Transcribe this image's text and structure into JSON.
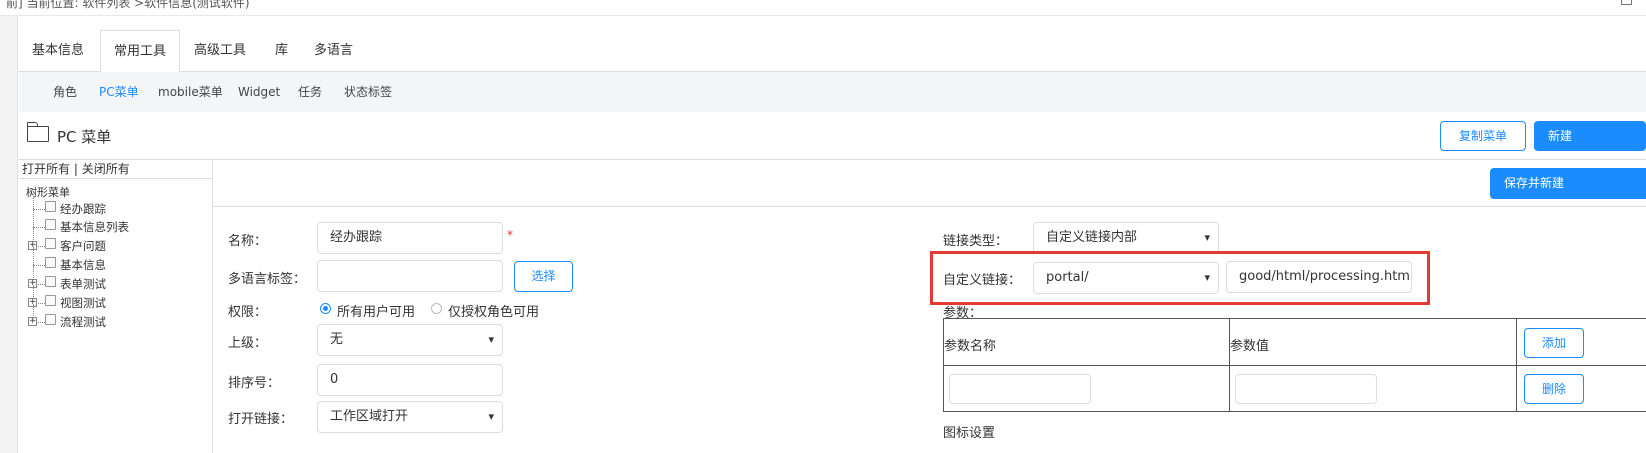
{
  "breadcrumb": {
    "text": "前]  当前位置: 软件列表 >软件信息(测试软件)"
  },
  "tabs": [
    {
      "label": "基本信息",
      "active": false
    },
    {
      "label": "常用工具",
      "active": true
    },
    {
      "label": "高级工具",
      "active": false
    },
    {
      "label": "库",
      "active": false
    },
    {
      "label": "多语言",
      "active": false
    }
  ],
  "subtabs": [
    {
      "label": "角色",
      "active": false
    },
    {
      "label": "PC菜单",
      "active": true
    },
    {
      "label": "mobile菜单",
      "active": false
    },
    {
      "label": "Widget",
      "active": false
    },
    {
      "label": "任务",
      "active": false
    },
    {
      "label": "状态标签",
      "active": false
    }
  ],
  "header": {
    "title": "PC 菜单",
    "copy_menu_label": "复制菜单",
    "new_label": "新建"
  },
  "tree": {
    "open_all": "打开所有",
    "separator": " | ",
    "close_all": "关闭所有",
    "root_label": "树形菜单",
    "items": [
      {
        "label": "经办跟踪",
        "expandable": false
      },
      {
        "label": "基本信息列表",
        "expandable": false
      },
      {
        "label": "客户问题",
        "expandable": true
      },
      {
        "label": "基本信息",
        "expandable": false
      },
      {
        "label": "表单测试",
        "expandable": true
      },
      {
        "label": "视图测试",
        "expandable": true
      },
      {
        "label": "流程测试",
        "expandable": true
      }
    ]
  },
  "form": {
    "save_new_label": "保存并新建",
    "name_label": "名称：",
    "name_value": "经办跟踪",
    "required_mark": "*",
    "i18n_label": "多语言标签：",
    "i18n_value": "",
    "select_button": "选择",
    "permission_label": "权限：",
    "permission_options": [
      {
        "label": "所有用户可用",
        "checked": true
      },
      {
        "label": "仅授权角色可用",
        "checked": false
      }
    ],
    "parent_label": "上级：",
    "parent_value": "无",
    "order_label": "排序号：",
    "order_value": "0",
    "open_link_label": "打开链接：",
    "open_link_value": "工作区域打开",
    "link_type_label": "链接类型：",
    "link_type_value": "自定义链接内部",
    "custom_link_label": "自定义链接：",
    "custom_link_prefix": "portal/",
    "custom_link_path": "good/html/processing.html",
    "params_label": "参数：",
    "param_name_header": "参数名称",
    "param_value_header": "参数值",
    "add_button": "添加",
    "delete_button": "删除",
    "icon_settings_label": "图标设置"
  },
  "colors": {
    "accent": "#1a8cff",
    "highlight": "#e53935"
  }
}
